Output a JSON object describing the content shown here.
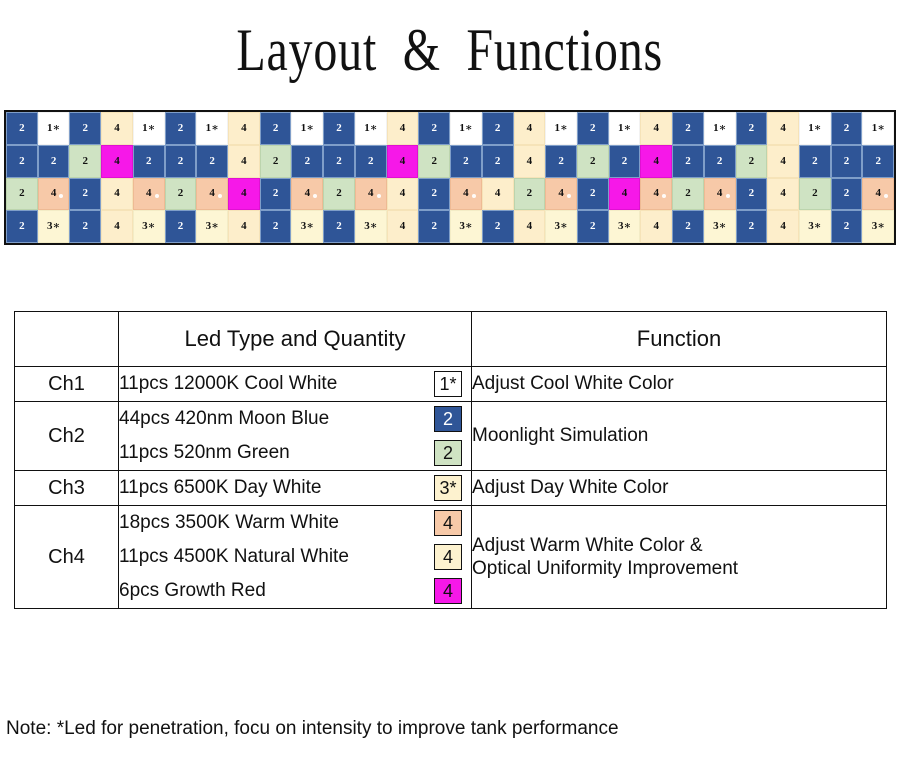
{
  "page": {
    "title": "Layout  &  Functions",
    "note": "Note: *Led for penetration, focu on intensity to improve tank performance"
  },
  "colors": {
    "blue": "#2f5597",
    "white": "#ffffff",
    "cream": "#fdeecb",
    "cream_light": "#fdf6d4",
    "green": "#cfe3c3",
    "peach": "#f7c9a8",
    "magenta": "#f618e8",
    "border": "#111111"
  },
  "led_grid": {
    "columns": 28,
    "rows": 4,
    "legend": {
      "1*": "12000K Cool White",
      "2_blue": "420nm Moon Blue",
      "2_green": "520nm Green",
      "3*": "6500K Day White",
      "4_peach": "3500K Warm White",
      "4_cream": "4500K Natural White",
      "4_magenta": "Growth Red"
    },
    "rows_data": [
      [
        {
          "label": "2",
          "color": "blue"
        },
        {
          "label": "1∗",
          "color": "white"
        },
        {
          "label": "2",
          "color": "blue"
        },
        {
          "label": "4",
          "color": "cream"
        },
        {
          "label": "1∗",
          "color": "white"
        },
        {
          "label": "2",
          "color": "blue"
        },
        {
          "label": "1∗",
          "color": "white"
        },
        {
          "label": "4",
          "color": "cream"
        },
        {
          "label": "2",
          "color": "blue"
        },
        {
          "label": "1∗",
          "color": "white"
        },
        {
          "label": "2",
          "color": "blue"
        },
        {
          "label": "1∗",
          "color": "white"
        },
        {
          "label": "4",
          "color": "cream"
        },
        {
          "label": "2",
          "color": "blue"
        },
        {
          "label": "1∗",
          "color": "white"
        },
        {
          "label": "2",
          "color": "blue"
        },
        {
          "label": "4",
          "color": "cream"
        },
        {
          "label": "1∗",
          "color": "white"
        },
        {
          "label": "2",
          "color": "blue"
        },
        {
          "label": "1∗",
          "color": "white"
        },
        {
          "label": "4",
          "color": "cream"
        },
        {
          "label": "2",
          "color": "blue"
        },
        {
          "label": "1∗",
          "color": "white"
        },
        {
          "label": "2",
          "color": "blue"
        },
        {
          "label": "4",
          "color": "cream"
        },
        {
          "label": "1∗",
          "color": "white"
        },
        {
          "label": "2",
          "color": "blue"
        },
        {
          "label": "1∗",
          "color": "white"
        }
      ],
      [
        {
          "label": "2",
          "color": "blue"
        },
        {
          "label": "2",
          "color": "blue"
        },
        {
          "label": "2",
          "color": "green"
        },
        {
          "label": "4",
          "color": "magenta"
        },
        {
          "label": "2",
          "color": "blue"
        },
        {
          "label": "2",
          "color": "blue"
        },
        {
          "label": "2",
          "color": "blue"
        },
        {
          "label": "4",
          "color": "cream"
        },
        {
          "label": "2",
          "color": "green"
        },
        {
          "label": "2",
          "color": "blue"
        },
        {
          "label": "2",
          "color": "blue"
        },
        {
          "label": "2",
          "color": "blue"
        },
        {
          "label": "4",
          "color": "magenta"
        },
        {
          "label": "2",
          "color": "green"
        },
        {
          "label": "2",
          "color": "blue"
        },
        {
          "label": "2",
          "color": "blue"
        },
        {
          "label": "4",
          "color": "cream"
        },
        {
          "label": "2",
          "color": "blue"
        },
        {
          "label": "2",
          "color": "green"
        },
        {
          "label": "2",
          "color": "blue"
        },
        {
          "label": "4",
          "color": "magenta"
        },
        {
          "label": "2",
          "color": "blue"
        },
        {
          "label": "2",
          "color": "blue"
        },
        {
          "label": "2",
          "color": "green"
        },
        {
          "label": "4",
          "color": "cream"
        },
        {
          "label": "2",
          "color": "blue"
        },
        {
          "label": "2",
          "color": "blue"
        },
        {
          "label": "2",
          "color": "blue"
        }
      ],
      [
        {
          "label": "2",
          "color": "green"
        },
        {
          "label": "4",
          "color": "peach",
          "sparkle": true
        },
        {
          "label": "2",
          "color": "blue"
        },
        {
          "label": "4",
          "color": "cream"
        },
        {
          "label": "4",
          "color": "peach",
          "sparkle": true
        },
        {
          "label": "2",
          "color": "green"
        },
        {
          "label": "4",
          "color": "peach",
          "sparkle": true
        },
        {
          "label": "4",
          "color": "magenta"
        },
        {
          "label": "2",
          "color": "blue"
        },
        {
          "label": "4",
          "color": "peach",
          "sparkle": true
        },
        {
          "label": "2",
          "color": "green"
        },
        {
          "label": "4",
          "color": "peach",
          "sparkle": true
        },
        {
          "label": "4",
          "color": "cream"
        },
        {
          "label": "2",
          "color": "blue"
        },
        {
          "label": "4",
          "color": "peach",
          "sparkle": true
        },
        {
          "label": "4",
          "color": "cream"
        },
        {
          "label": "2",
          "color": "green"
        },
        {
          "label": "4",
          "color": "peach",
          "sparkle": true
        },
        {
          "label": "2",
          "color": "blue"
        },
        {
          "label": "4",
          "color": "magenta"
        },
        {
          "label": "4",
          "color": "peach",
          "sparkle": true
        },
        {
          "label": "2",
          "color": "green"
        },
        {
          "label": "4",
          "color": "peach",
          "sparkle": true
        },
        {
          "label": "2",
          "color": "blue"
        },
        {
          "label": "4",
          "color": "cream"
        },
        {
          "label": "2",
          "color": "green"
        },
        {
          "label": "2",
          "color": "blue"
        },
        {
          "label": "4",
          "color": "peach",
          "sparkle": true
        }
      ],
      [
        {
          "label": "2",
          "color": "blue"
        },
        {
          "label": "3∗",
          "color": "cream_light"
        },
        {
          "label": "2",
          "color": "blue"
        },
        {
          "label": "4",
          "color": "cream"
        },
        {
          "label": "3∗",
          "color": "cream_light"
        },
        {
          "label": "2",
          "color": "blue"
        },
        {
          "label": "3∗",
          "color": "cream_light"
        },
        {
          "label": "4",
          "color": "cream"
        },
        {
          "label": "2",
          "color": "blue"
        },
        {
          "label": "3∗",
          "color": "cream_light"
        },
        {
          "label": "2",
          "color": "blue"
        },
        {
          "label": "3∗",
          "color": "cream_light"
        },
        {
          "label": "4",
          "color": "cream"
        },
        {
          "label": "2",
          "color": "blue"
        },
        {
          "label": "3∗",
          "color": "cream_light"
        },
        {
          "label": "2",
          "color": "blue"
        },
        {
          "label": "4",
          "color": "cream"
        },
        {
          "label": "3∗",
          "color": "cream_light"
        },
        {
          "label": "2",
          "color": "blue"
        },
        {
          "label": "3∗",
          "color": "cream_light"
        },
        {
          "label": "4",
          "color": "cream"
        },
        {
          "label": "2",
          "color": "blue"
        },
        {
          "label": "3∗",
          "color": "cream_light"
        },
        {
          "label": "2",
          "color": "blue"
        },
        {
          "label": "4",
          "color": "cream"
        },
        {
          "label": "3∗",
          "color": "cream_light"
        },
        {
          "label": "2",
          "color": "blue"
        },
        {
          "label": "3∗",
          "color": "cream_light"
        }
      ]
    ]
  },
  "table": {
    "headers": {
      "channel": "",
      "led": "Led Type and Quantity",
      "function": "Function"
    },
    "rows": [
      {
        "channel": "Ch1",
        "leds": [
          {
            "text": "11pcs 12000K Cool White",
            "badge": "1*",
            "badge_color": "white"
          }
        ],
        "function": [
          "Adjust Cool White Color"
        ]
      },
      {
        "channel": "Ch2",
        "leds": [
          {
            "text": "44pcs 420nm Moon Blue",
            "badge": "2",
            "badge_color": "blue"
          },
          {
            "text": "11pcs 520nm Green",
            "badge": "2",
            "badge_color": "green"
          }
        ],
        "function": [
          "Moonlight Simulation"
        ]
      },
      {
        "channel": "Ch3",
        "leds": [
          {
            "text": "11pcs 6500K Day White",
            "badge": "3*",
            "badge_color": "cream"
          }
        ],
        "function": [
          "Adjust Day White Color"
        ]
      },
      {
        "channel": "Ch4",
        "leds": [
          {
            "text": "18pcs 3500K Warm White",
            "badge": "4",
            "badge_color": "peach"
          },
          {
            "text": "11pcs 4500K Natural White",
            "badge": "4",
            "badge_color": "cream"
          },
          {
            "text": "6pcs Growth Red",
            "badge": "4",
            "badge_color": "magenta"
          }
        ],
        "function": [
          "Adjust Warm White Color &",
          "Optical Uniformity Improvement"
        ]
      }
    ]
  }
}
